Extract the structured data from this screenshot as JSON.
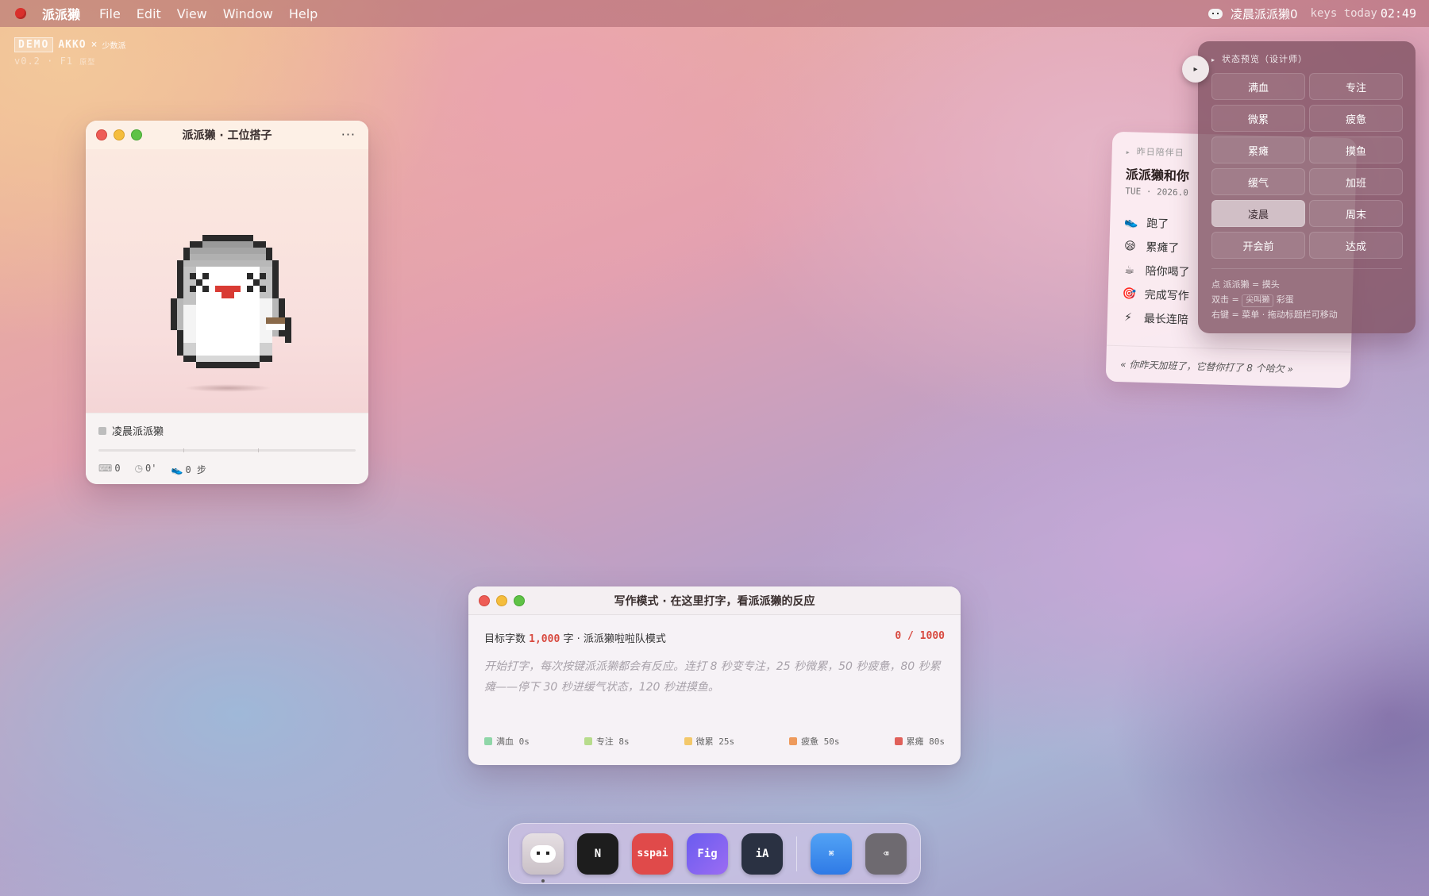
{
  "menubar": {
    "app_name": "派派獭",
    "menus": [
      "File",
      "Edit",
      "View",
      "Window",
      "Help"
    ],
    "tray_label": "凌晨派派獭0",
    "keys_label": "keys today",
    "clock": "02:49"
  },
  "demo_badge": {
    "tag": "DEMO",
    "brand": "AKKO",
    "times": "×",
    "partner": "少数派",
    "version": "v0.2 · F1",
    "version_note": "原型"
  },
  "pet_window": {
    "title": "派派獭 · 工位搭子",
    "more_label": "···",
    "status_label": "凌晨派派獭",
    "stats": {
      "keys": "0",
      "minutes": "0'",
      "steps": "0 步"
    }
  },
  "companion_card": {
    "eyebrow": "昨日陪伴日",
    "title": "派派獭和你",
    "date": "TUE · 2026.0",
    "items": [
      {
        "icon": "shoe-icon",
        "glyph": "👟",
        "label": "跑了"
      },
      {
        "icon": "sleepy-face-icon",
        "glyph": "😪",
        "label": "累瘫了"
      },
      {
        "icon": "coffee-icon",
        "glyph": "☕",
        "label": "陪你喝了"
      },
      {
        "icon": "target-icon",
        "glyph": "🎯",
        "label": "完成写作"
      },
      {
        "icon": "lightning-icon",
        "glyph": "⚡",
        "label": "最长连陪"
      }
    ],
    "quote": "« 你昨天加班了，它替你打了 8 个哈欠 »"
  },
  "state_panel": {
    "toggle_glyph": "▸",
    "heading": "状态预览（设计师）",
    "states": [
      {
        "label": "满血",
        "active": false
      },
      {
        "label": "专注",
        "active": false
      },
      {
        "label": "微累",
        "active": false
      },
      {
        "label": "疲惫",
        "active": false
      },
      {
        "label": "累瘫",
        "active": false
      },
      {
        "label": "摸鱼",
        "active": false
      },
      {
        "label": "缓气",
        "active": false
      },
      {
        "label": "加班",
        "active": false
      },
      {
        "label": "凌晨",
        "active": true
      },
      {
        "label": "周末",
        "active": false
      },
      {
        "label": "开会前",
        "active": false
      },
      {
        "label": "达成",
        "active": false
      }
    ],
    "help": {
      "line1": "点 派派獭 = 摸头",
      "line2_pre": "双击 =",
      "line2_key": "尖叫獭",
      "line2_post": "彩蛋",
      "line3": "右键 = 菜单 · 拖动标题栏可移动"
    }
  },
  "write_window": {
    "title": "写作模式 · 在这里打字，看派派獭的反应",
    "goal_prefix": "目标字数",
    "goal_value": "1,000",
    "goal_suffix": "字 · 派派獭啦啦队模式",
    "counter": "0 / 1000",
    "placeholder": "开始打字，每次按键派派獭都会有反应。连打 8 秒变专注，25 秒微累，50 秒疲惫，80 秒累瘫——停下 30 秒进缓气状态，120 秒进摸鱼。",
    "legend": [
      {
        "label": "满血 0s",
        "color": "#8fd6a8"
      },
      {
        "label": "专注 8s",
        "color": "#b7dc8c"
      },
      {
        "label": "微累 25s",
        "color": "#f3c86a"
      },
      {
        "label": "疲惫 50s",
        "color": "#ee9a5c"
      },
      {
        "label": "累瘫 80s",
        "color": "#e0605a"
      }
    ]
  },
  "dock": {
    "apps": [
      {
        "name": "paipaita",
        "label": "",
        "color": "#d9d2d6"
      },
      {
        "name": "notion",
        "label": "N",
        "color": "#1d1d1d"
      },
      {
        "name": "sspai",
        "label": "sspai",
        "color": "#e04a4a"
      },
      {
        "name": "figma",
        "label": "Fig",
        "color": "#7a5cf0"
      },
      {
        "name": "ia-writer",
        "label": "iA",
        "color": "#2a3142"
      },
      {
        "name": "finder",
        "label": "⌘",
        "color": "#3d8ef0"
      },
      {
        "name": "trash",
        "label": "⌫",
        "color": "#6e6a70"
      }
    ]
  }
}
